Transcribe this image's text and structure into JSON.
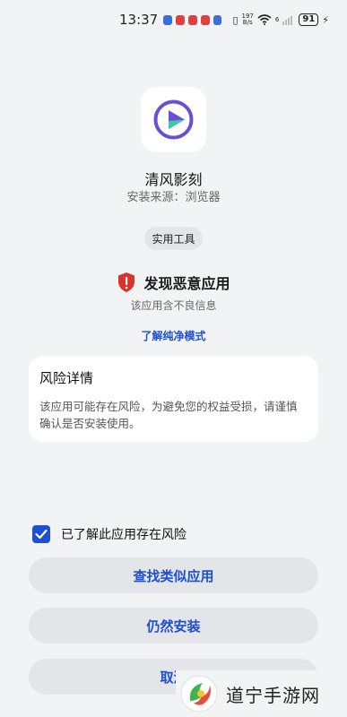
{
  "status_bar": {
    "time": "13:37",
    "speed_value": "197",
    "speed_unit": "B/s",
    "network": "6",
    "battery": "91",
    "notification_colors": [
      "#3b6fd8",
      "#e04040",
      "#e04040",
      "#e04040",
      "#3b6fd8"
    ]
  },
  "app": {
    "name": "清风影刻",
    "source": "安装来源：浏览器",
    "icon": "play-circle-icon",
    "category_tag": "实用工具"
  },
  "warning": {
    "title": "发现恶意应用",
    "subtitle": "该应用含不良信息",
    "link": "了解纯净模式",
    "icon": "shield-alert-icon"
  },
  "risk_card": {
    "title": "风险详情",
    "body": "该应用可能存在风险，为避免您的权益受损，请谨慎确认是否安装使用。"
  },
  "confirm": {
    "checked": true,
    "label": "已了解此应用存在风险"
  },
  "buttons": {
    "find_similar": "查找类似应用",
    "install_anyway": "仍然安装",
    "cancel": "取消"
  },
  "watermark": {
    "text": "道宁手游网"
  },
  "colors": {
    "accent": "#1e4fd1",
    "danger": "#d8342c",
    "icon_purple": "#6a4fd6",
    "icon_green": "#3fc9a0"
  }
}
